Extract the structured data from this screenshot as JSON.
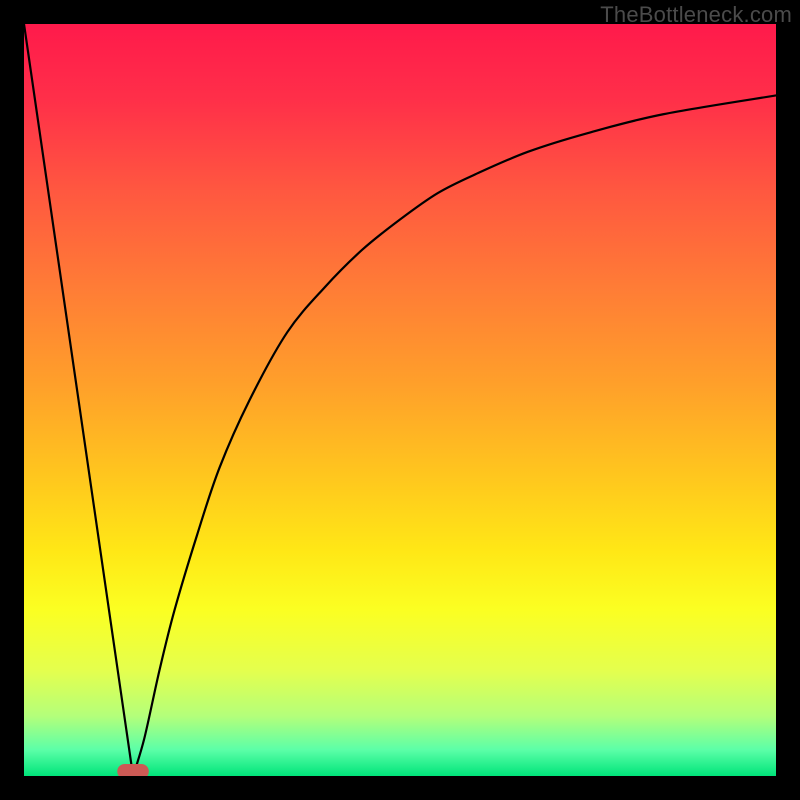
{
  "watermark": "TheBottleneck.com",
  "chart_data": {
    "type": "line",
    "title": "",
    "xlabel": "",
    "ylabel": "",
    "xlim": [
      0,
      100
    ],
    "ylim": [
      0,
      100
    ],
    "series": [
      {
        "name": "curve-left",
        "x": [
          0,
          14.5
        ],
        "y": [
          100,
          0
        ]
      },
      {
        "name": "curve-right",
        "x": [
          14.5,
          16,
          18,
          20,
          23,
          26,
          30,
          35,
          40,
          45,
          50,
          55,
          60,
          67,
          75,
          85,
          100
        ],
        "y": [
          0,
          5,
          14,
          22,
          32,
          41,
          50,
          59,
          65,
          70,
          74,
          77.5,
          80,
          83,
          85.5,
          88,
          90.5
        ]
      }
    ],
    "marker": {
      "x": 14.5,
      "width": 4.2,
      "height": 2.0,
      "y": 0.6,
      "color": "#cc5a55"
    },
    "gradient_stops": [
      {
        "offset": 0,
        "color": "#ff1a4b"
      },
      {
        "offset": 0.1,
        "color": "#ff2f49"
      },
      {
        "offset": 0.22,
        "color": "#ff5740"
      },
      {
        "offset": 0.35,
        "color": "#ff7c36"
      },
      {
        "offset": 0.48,
        "color": "#ffa02a"
      },
      {
        "offset": 0.6,
        "color": "#ffc61e"
      },
      {
        "offset": 0.7,
        "color": "#ffe716"
      },
      {
        "offset": 0.78,
        "color": "#fbff22"
      },
      {
        "offset": 0.86,
        "color": "#e4ff4e"
      },
      {
        "offset": 0.92,
        "color": "#b4ff7a"
      },
      {
        "offset": 0.965,
        "color": "#5cffa8"
      },
      {
        "offset": 1.0,
        "color": "#00e47a"
      }
    ]
  }
}
